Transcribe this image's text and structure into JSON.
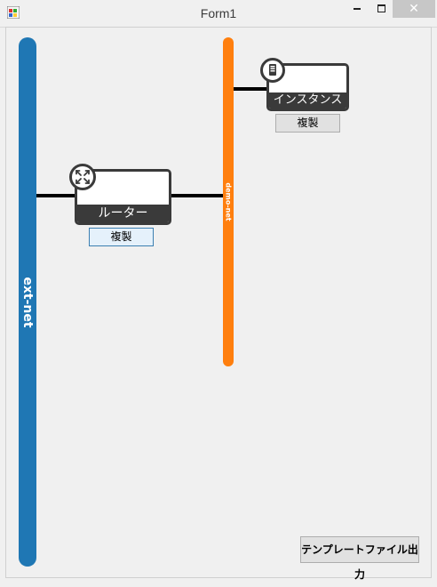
{
  "window": {
    "title": "Form1",
    "close_glyph": "✕",
    "icons": {
      "app": "app-form-icon",
      "minimize": "minimize-icon",
      "maximize": "maximize-icon",
      "close": "close-icon"
    }
  },
  "networks": {
    "ext_net": {
      "label": "ext-net",
      "color": "#1f77b4"
    },
    "demo_net": {
      "label": "demo-net",
      "color": "#ff7f0e"
    }
  },
  "nodes": {
    "router": {
      "label": "ルーター",
      "icon": "router-icon",
      "duplicate_label": "複製"
    },
    "instance": {
      "label": "インスタンス",
      "icon": "server-icon",
      "duplicate_label": "複製"
    }
  },
  "export_button": {
    "label": "テンプレートファイル出力"
  }
}
